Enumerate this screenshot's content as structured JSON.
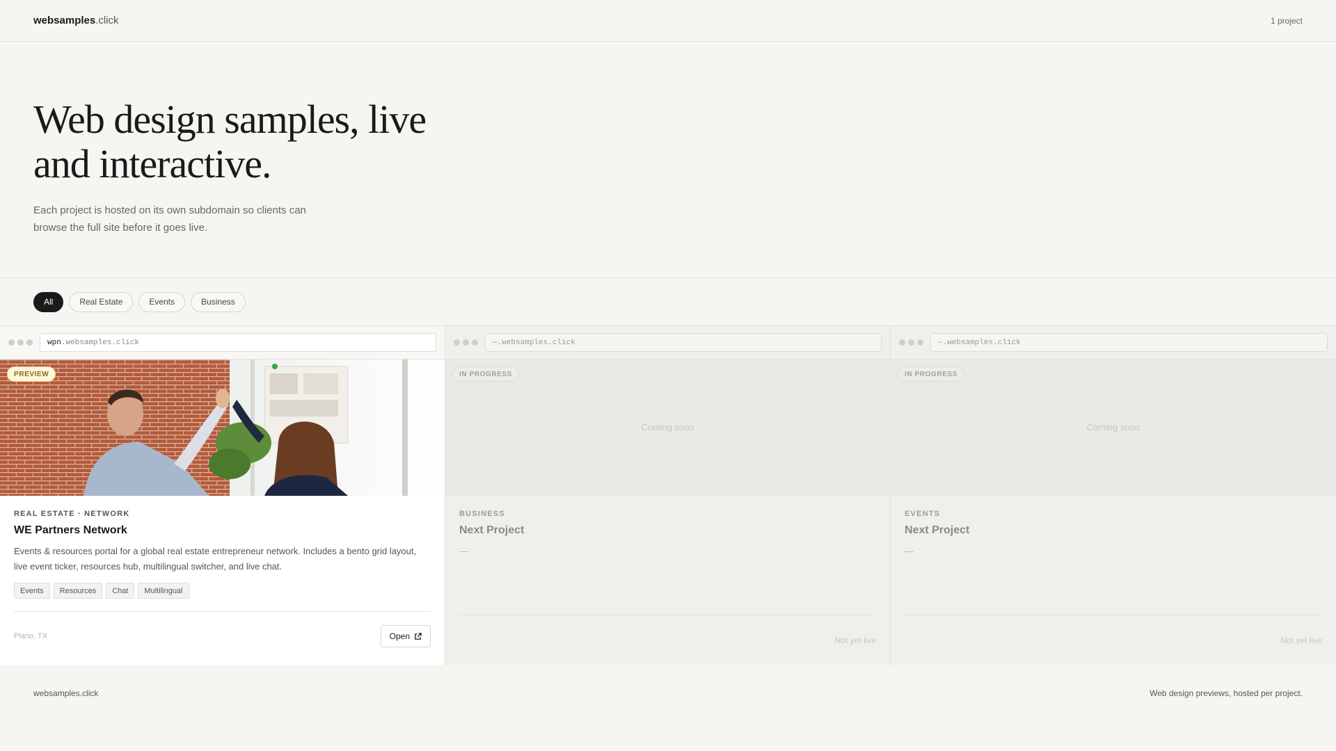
{
  "header": {
    "brand_strong": "websamples",
    "brand_light": ".click",
    "project_count": "1 project"
  },
  "hero": {
    "title": "Web design samples, live and interactive.",
    "subtitle": "Each project is hosted on its own subdomain so clients can browse the full site before it goes live."
  },
  "filters": [
    "All",
    "Real Estate",
    "Events",
    "Business"
  ],
  "cards": [
    {
      "url_sub": "wpn",
      "url_domain": ".websamples.click",
      "badge": "PREVIEW",
      "kicker": "REAL ESTATE · NETWORK",
      "title": "WE Partners Network",
      "description": "Events & resources portal for a global real estate entrepreneur network. Includes a bento grid layout, live event ticker, resources hub, multilingual switcher, and live chat.",
      "tags": [
        "Events",
        "Resources",
        "Chat",
        "Multilingual"
      ],
      "location": "Plano, TX",
      "action": "Open"
    },
    {
      "url": "—.websamples.click",
      "badge": "IN PROGRESS",
      "placeholder": "Coming soon",
      "kicker": "BUSINESS",
      "title": "Next Project",
      "description": "—",
      "status": "Not yet live"
    },
    {
      "url": "—.websamples.click",
      "badge": "IN PROGRESS",
      "placeholder": "Coming soon",
      "kicker": "EVENTS",
      "title": "Next Project",
      "description": "—",
      "status": "Not yet live"
    }
  ],
  "footer": {
    "left": "websamples.click",
    "right": "Web design previews, hosted per project."
  }
}
